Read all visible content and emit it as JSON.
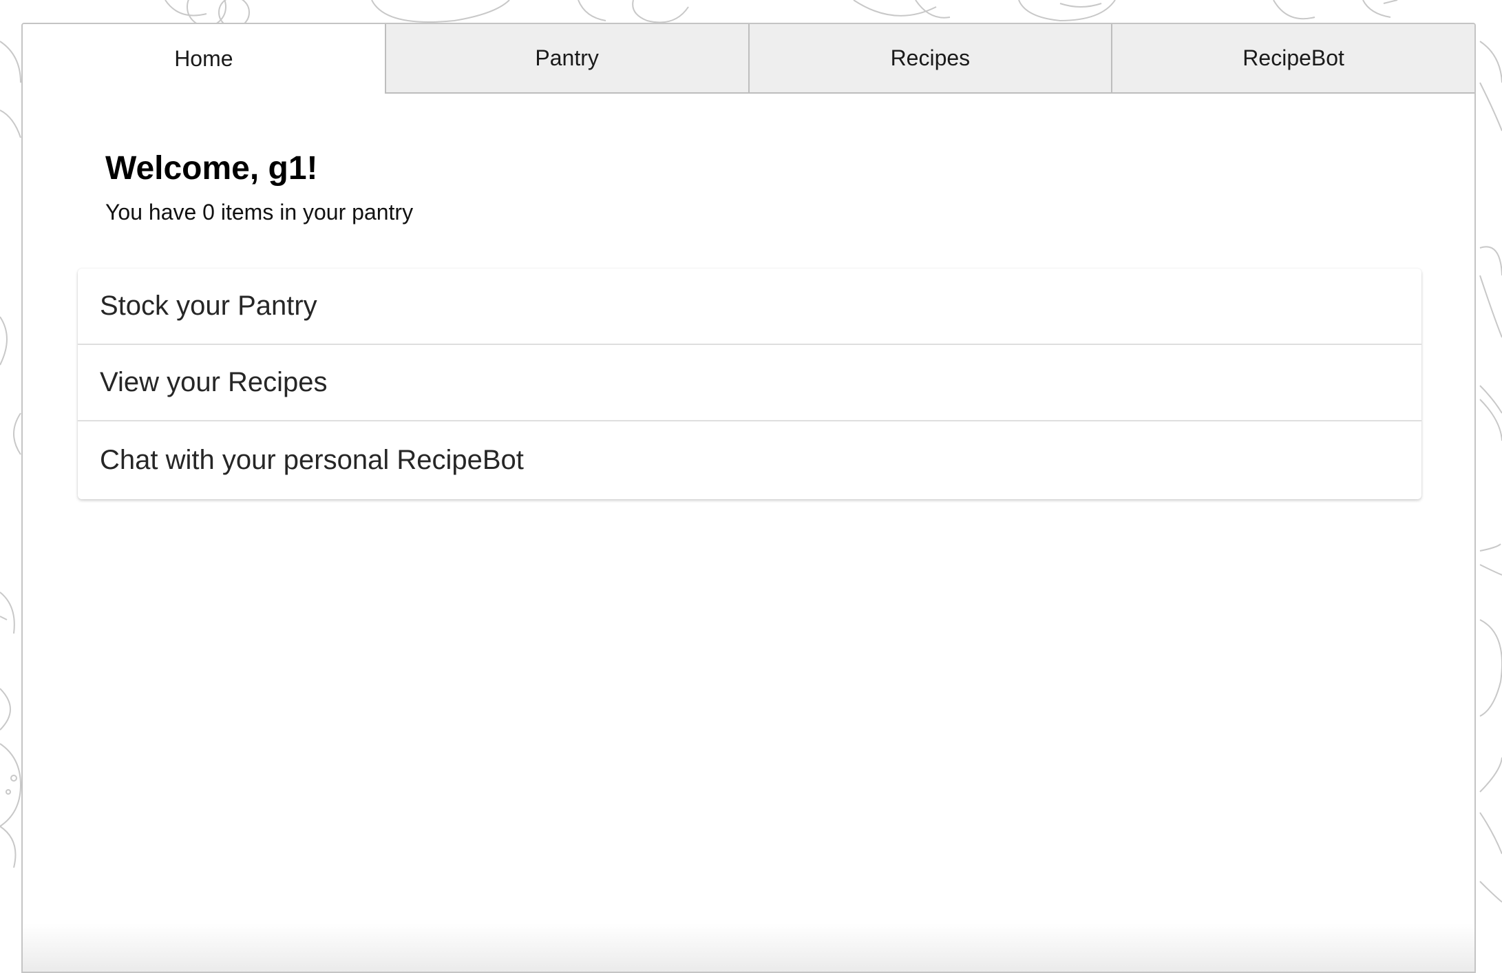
{
  "tabs": [
    {
      "label": "Home",
      "active": true
    },
    {
      "label": "Pantry",
      "active": false
    },
    {
      "label": "Recipes",
      "active": false
    },
    {
      "label": "RecipeBot",
      "active": false
    }
  ],
  "home": {
    "welcome": "Welcome, g1!",
    "pantry_summary": "You have 0 items in your pantry"
  },
  "actions": [
    {
      "label": "Stock your Pantry"
    },
    {
      "label": "View your Recipes"
    },
    {
      "label": "Chat with your personal RecipeBot"
    }
  ],
  "colors": {
    "tab_inactive_bg": "#eeeeee",
    "border": "#bdbdbd",
    "background_doodle_stroke": "#c8c8c8"
  }
}
